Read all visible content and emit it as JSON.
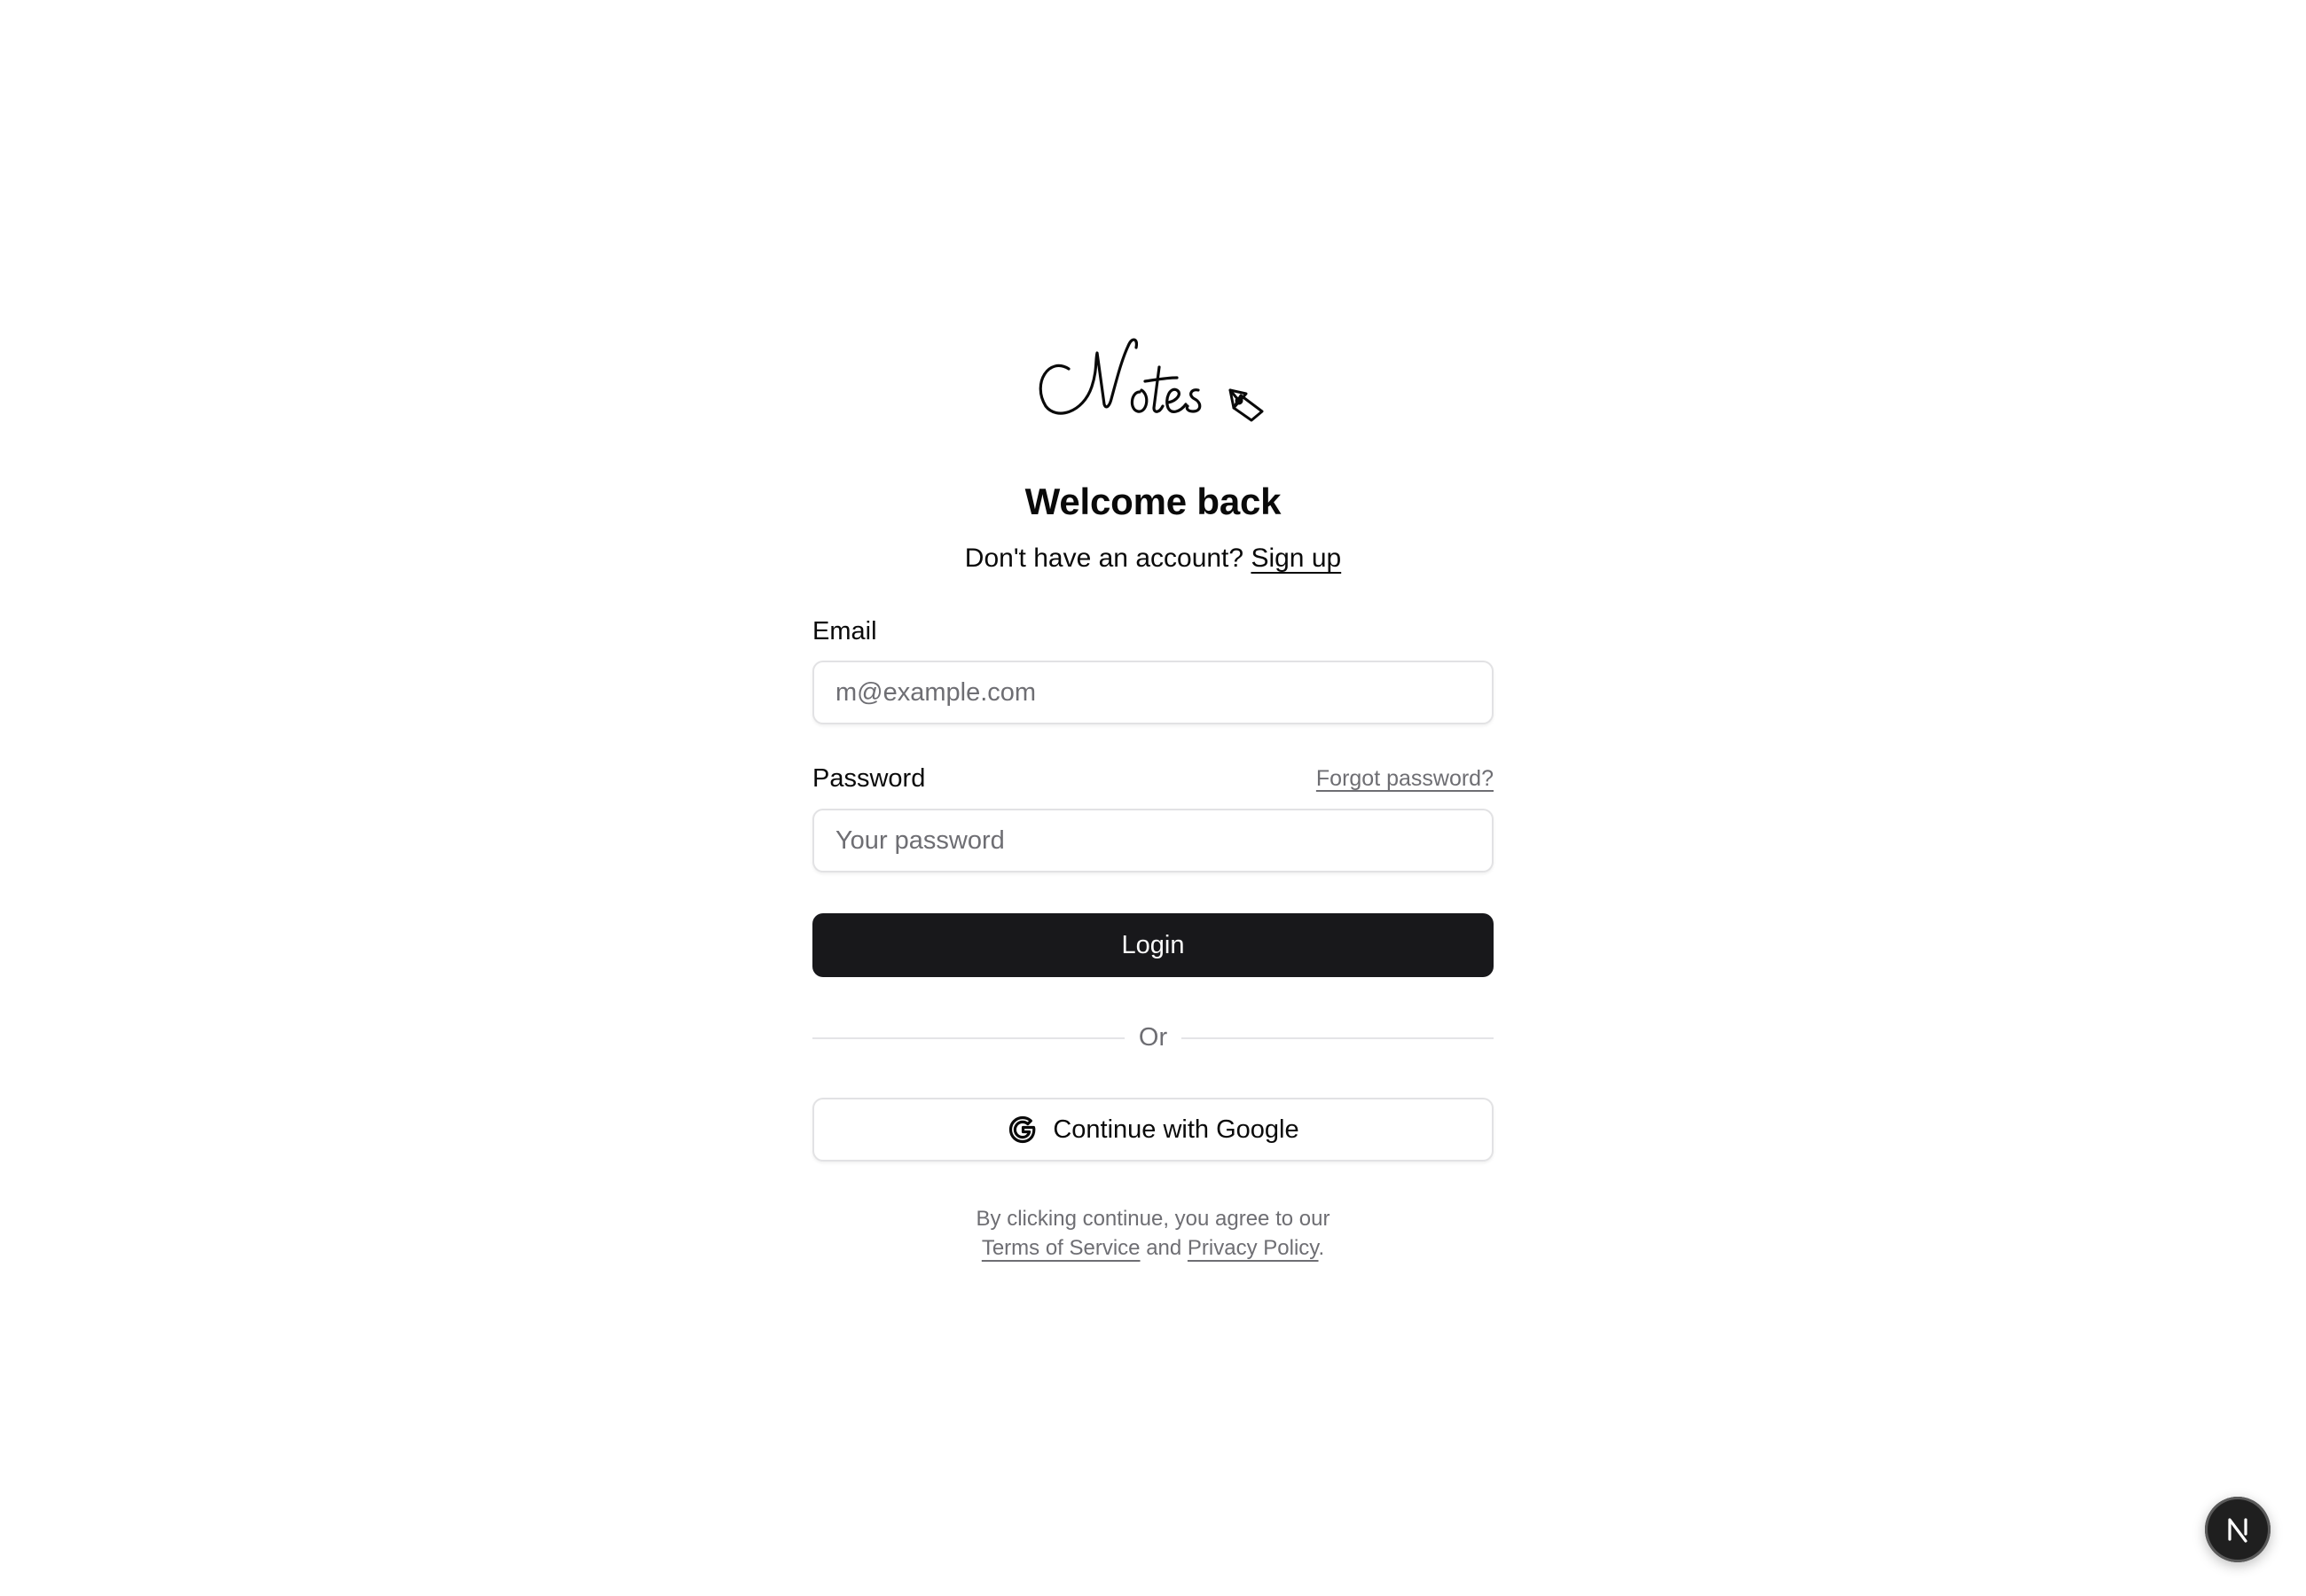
{
  "app": {
    "logo_text": "Notes",
    "logo_icon": "fountain-pen-nib-icon"
  },
  "header": {
    "title": "Welcome back",
    "signup_prompt": "Don't have an account?",
    "signup_link": "Sign up"
  },
  "form": {
    "email": {
      "label": "Email",
      "placeholder": "m@example.com",
      "value": ""
    },
    "password": {
      "label": "Password",
      "placeholder": "Your password",
      "value": "",
      "forgot_link": "Forgot password?"
    },
    "login_button": "Login",
    "divider_text": "Or",
    "google_button": "Continue with Google",
    "google_icon": "google-g-icon"
  },
  "legal": {
    "prefix": "By clicking continue, you agree to our",
    "terms_link": "Terms of Service",
    "and_text": "and",
    "privacy_link": "Privacy Policy",
    "suffix": "."
  },
  "dev_badge": {
    "icon": "nextjs-n-icon"
  },
  "colors": {
    "primary_button": "#18181b",
    "primary_button_text": "#fafafa",
    "muted_text": "#6e6e73",
    "border": "#e2e2e4"
  }
}
